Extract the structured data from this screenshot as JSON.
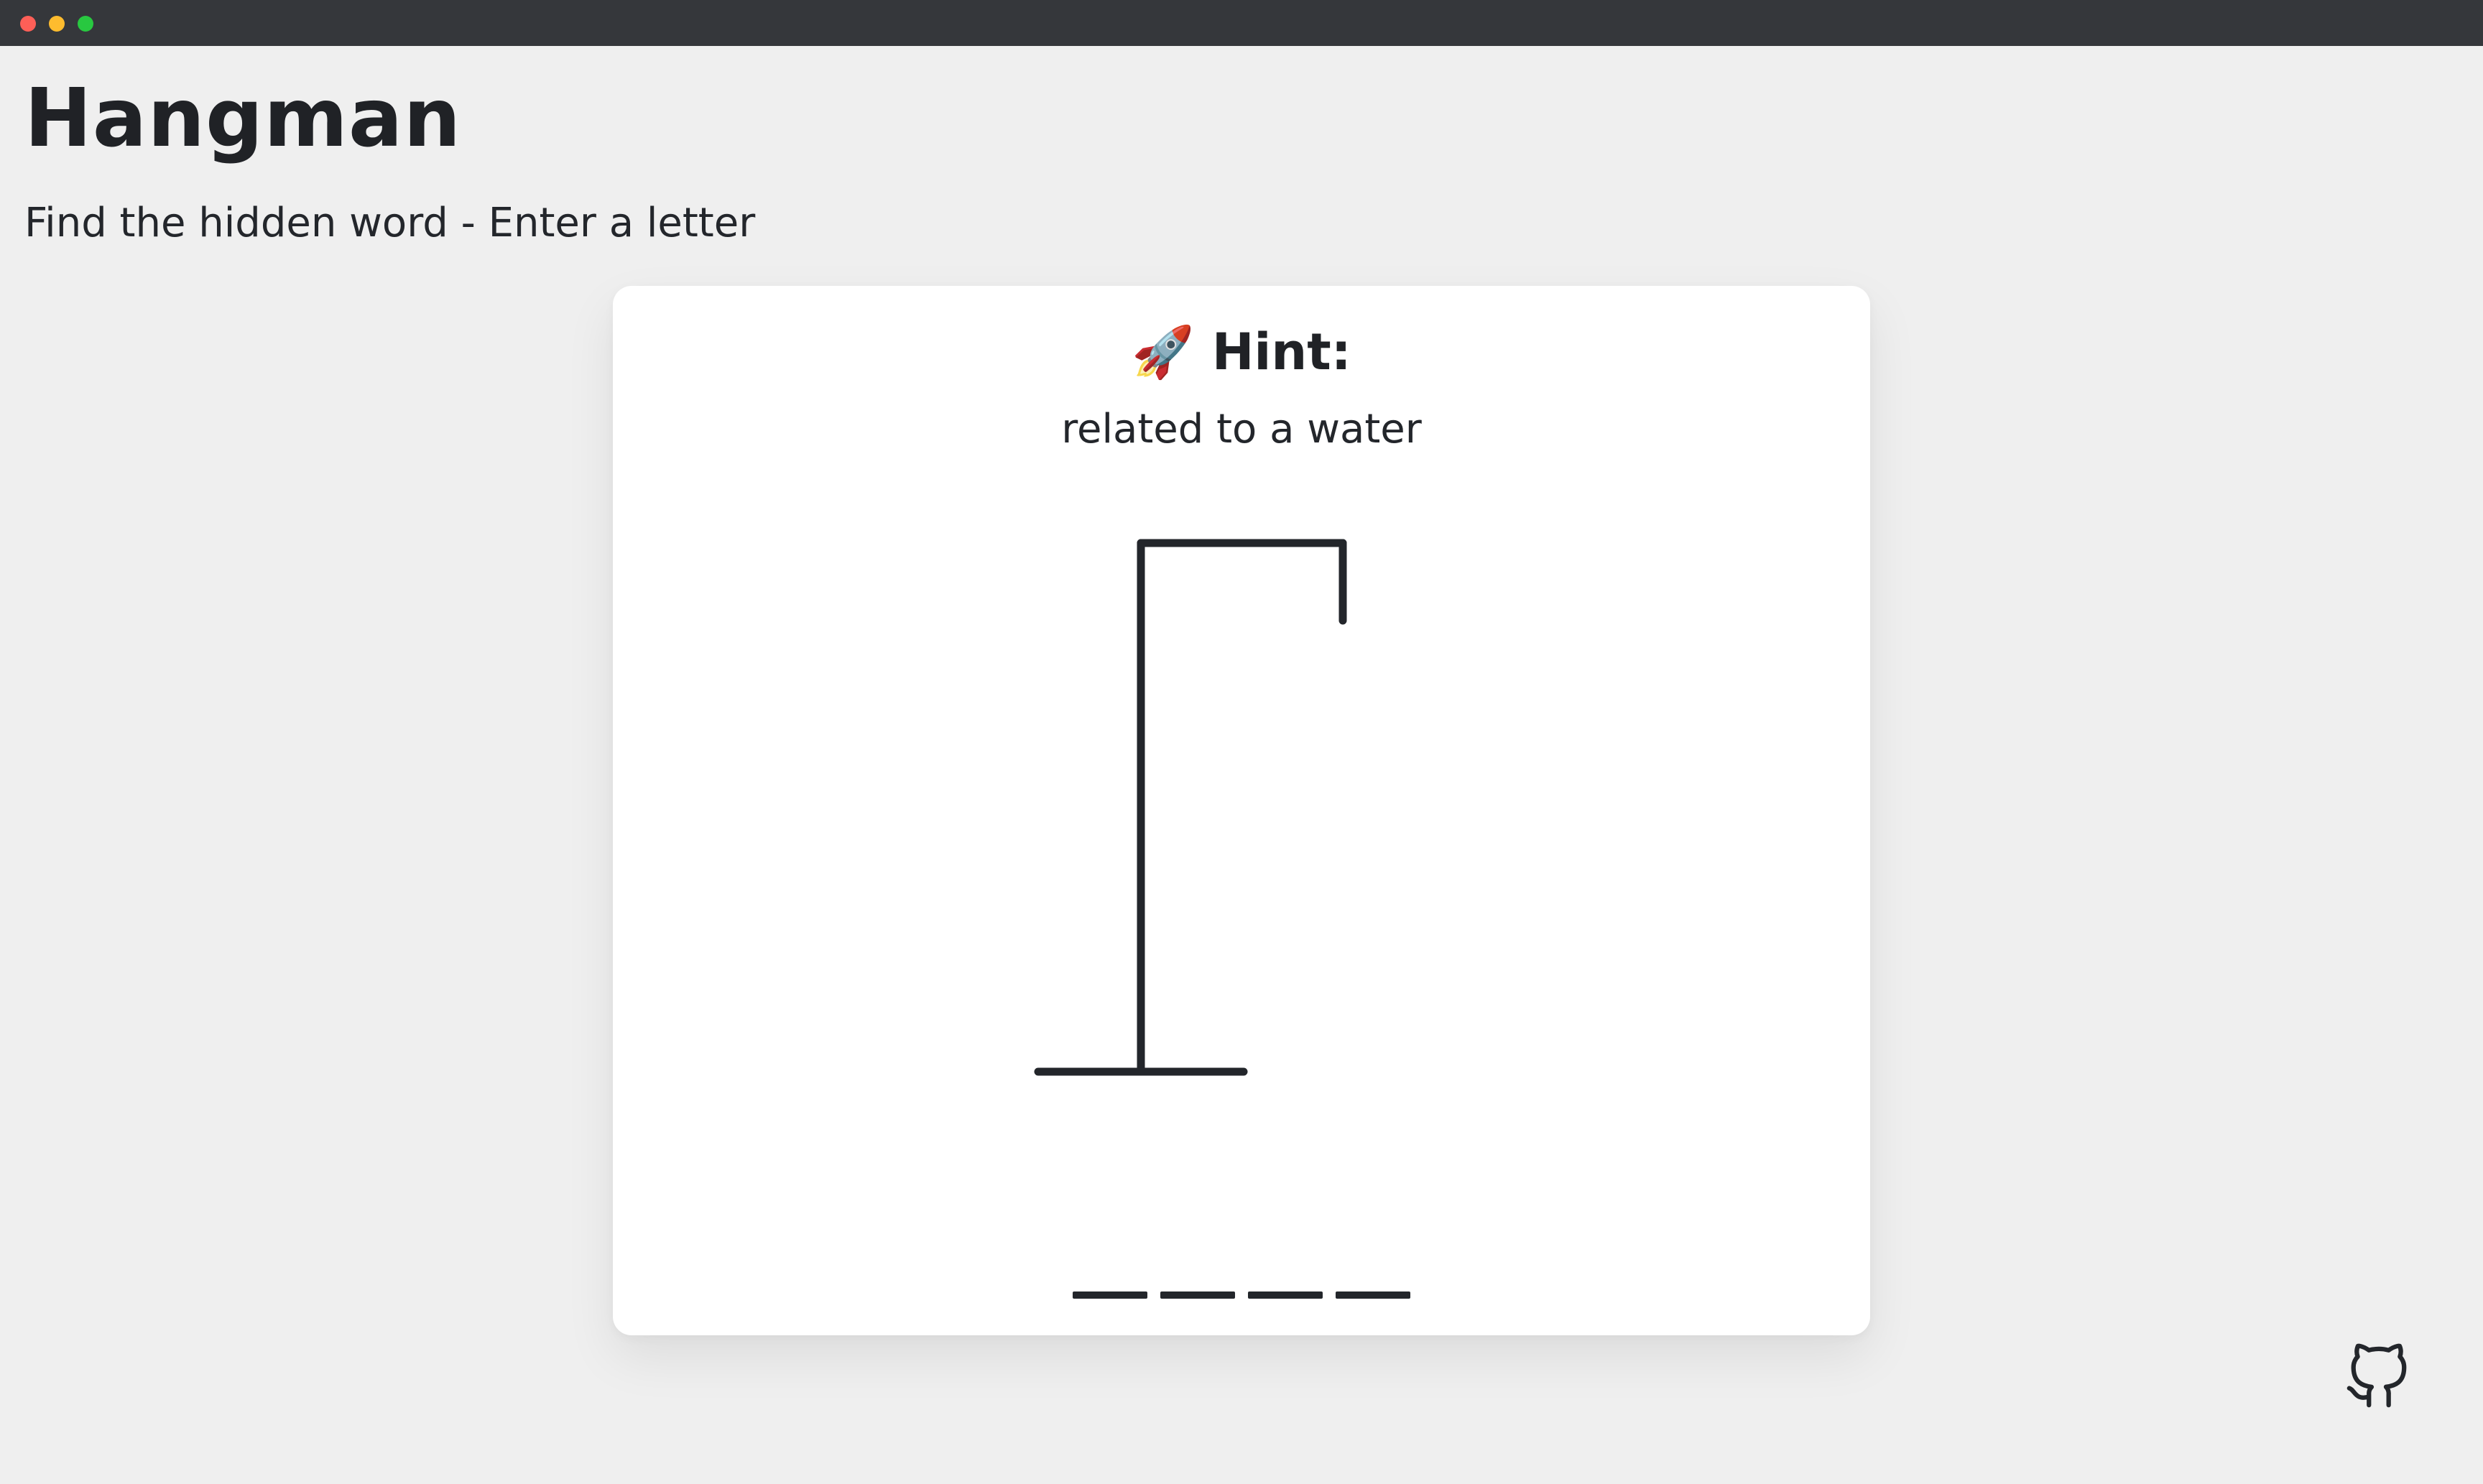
{
  "window": {
    "controls": [
      "close",
      "minimize",
      "maximize"
    ]
  },
  "header": {
    "title": "Hangman",
    "subtitle": "Find the hidden word - Enter a letter"
  },
  "card": {
    "hint_icon": "rocket-icon",
    "hint_emoji": "🚀",
    "hint_label": "Hint:",
    "hint_text": "related to a water"
  },
  "game": {
    "hidden_word_length": 4,
    "revealed_letters": [
      "",
      "",
      "",
      ""
    ],
    "drawn_parts": [
      "base",
      "pole",
      "beam",
      "rope"
    ],
    "wrong_guesses": 0
  },
  "footer": {
    "github_icon": "github-icon"
  },
  "colors": {
    "background": "#efefef",
    "card": "#ffffff",
    "ink": "#23262b",
    "titlebar": "#35373b",
    "close": "#fe5f57",
    "minimize": "#febc2e",
    "maximize": "#28c840"
  }
}
